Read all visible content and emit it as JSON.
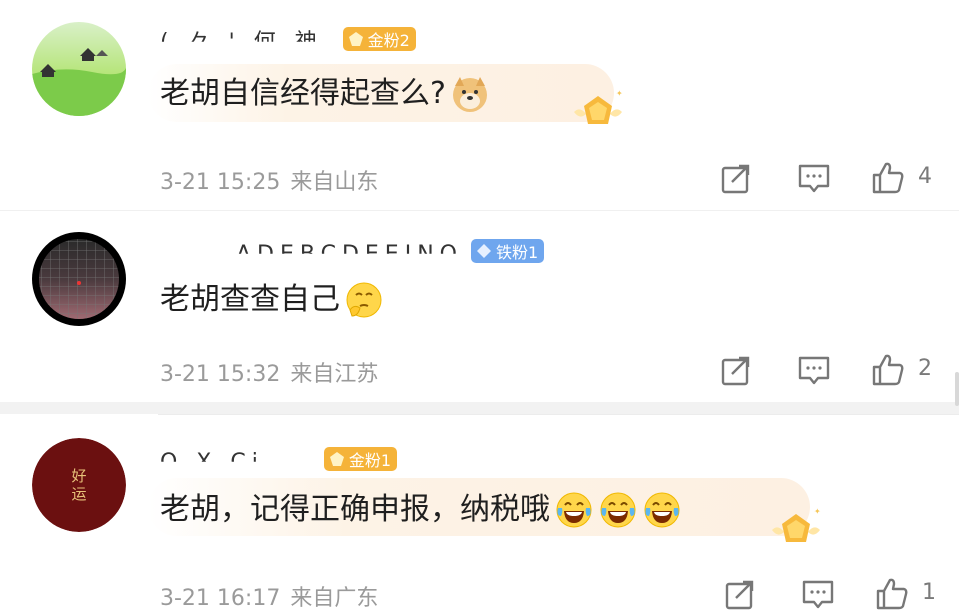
{
  "comments": [
    {
      "username": "( 々 ' 何 神",
      "badge": {
        "label": "金粉2",
        "kind": "gold"
      },
      "text": "老胡自信经得起查么?",
      "emojis": [
        "doge-emoji"
      ],
      "time": "3-21 15:25",
      "location": "来自山东",
      "likes": "4"
    },
    {
      "username": "ADEBCDEEINO",
      "badge": {
        "label": "铁粉1",
        "kind": "iron"
      },
      "text": "老胡查查自己",
      "emojis": [
        "thinking-emoji"
      ],
      "time": "3-21 15:32",
      "location": "来自江苏",
      "likes": "2"
    },
    {
      "username": "O X Ci",
      "badge": {
        "label": "金粉1",
        "kind": "gold"
      },
      "text": "老胡，记得正确申报，纳税哦",
      "emojis": [
        "laugh-cry-emoji",
        "laugh-cry-emoji",
        "laugh-cry-emoji"
      ],
      "time": "3-21 16:17",
      "location": "来自广东",
      "likes": "1",
      "avatar_text": "好运"
    }
  ],
  "colors": {
    "gold_badge": "#f5b339",
    "iron_badge": "#6fa6ee",
    "meta_text": "#9a9a9a",
    "bubble": "#fdf0e2"
  },
  "icons": {
    "share": "share-icon",
    "comment": "comment-icon",
    "like": "like-icon",
    "medal": "fan-medal-icon"
  }
}
